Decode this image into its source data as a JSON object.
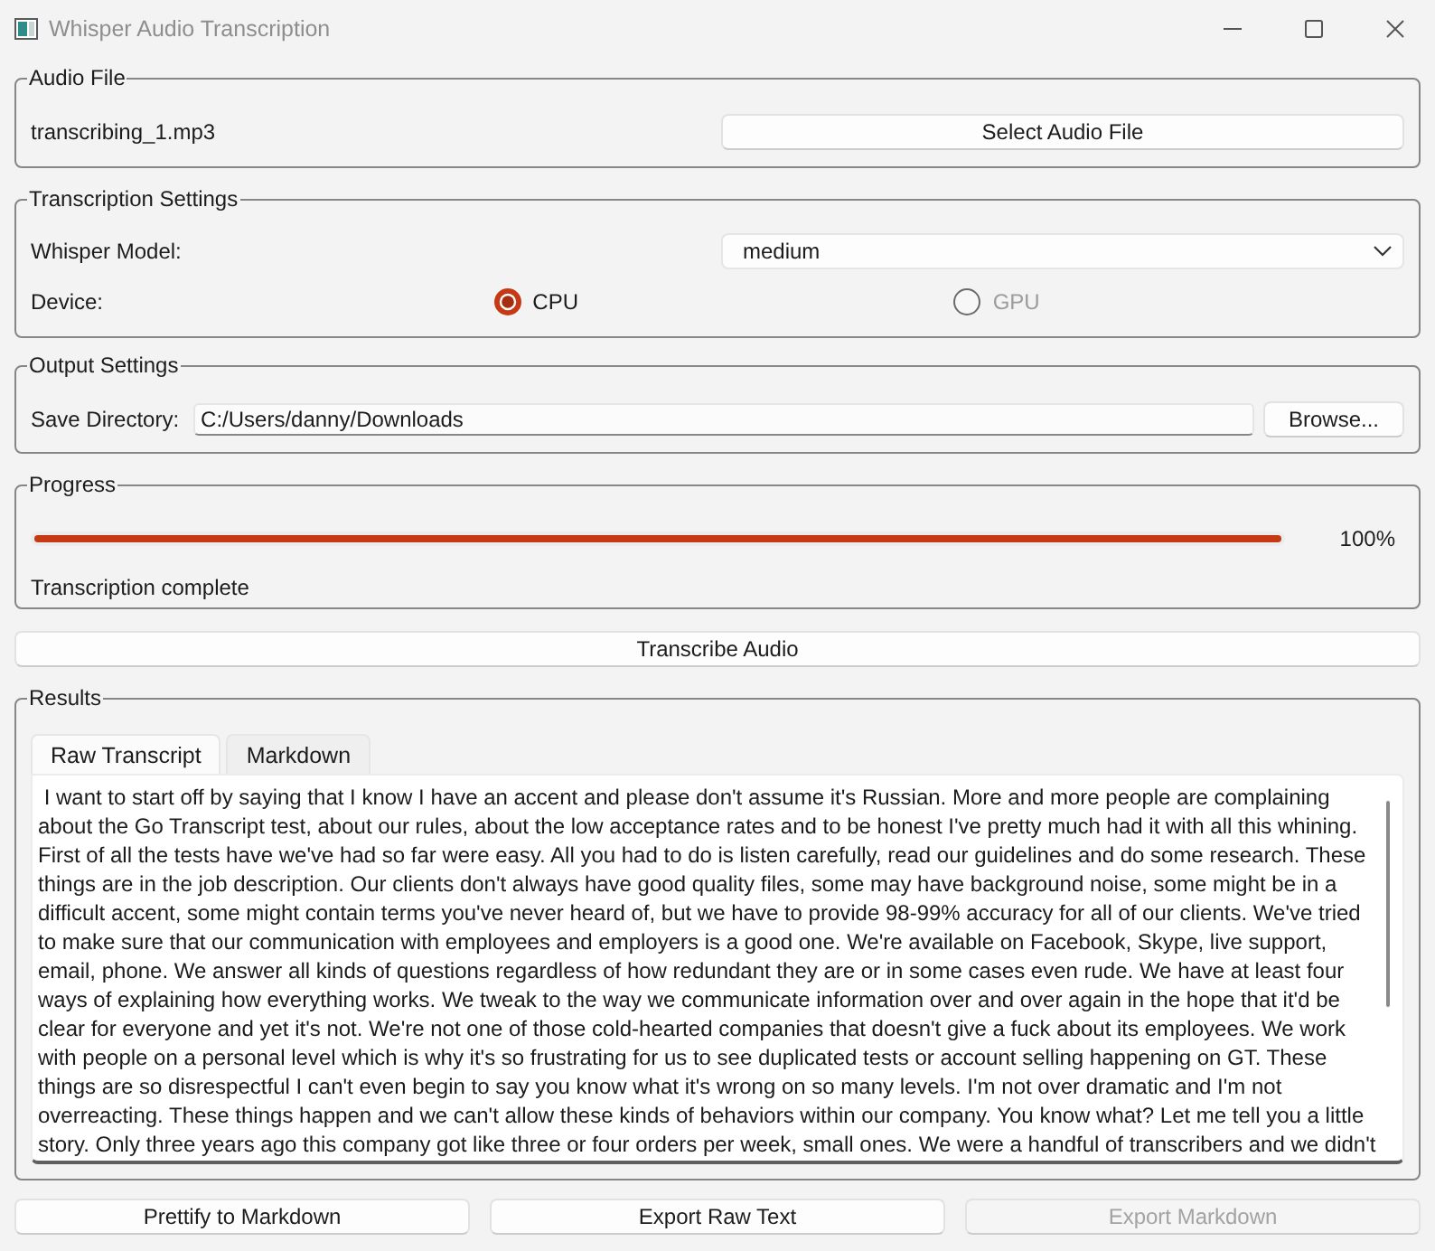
{
  "window": {
    "title": "Whisper Audio Transcription"
  },
  "audio_file": {
    "title": "Audio File",
    "file_name": "transcribing_1.mp3",
    "button": "Select Audio File"
  },
  "transcription_settings": {
    "title": "Transcription Settings",
    "model_label": "Whisper Model:",
    "model_value": "medium",
    "device_label": "Device:",
    "devices": [
      {
        "label": "CPU",
        "selected": true,
        "disabled": false
      },
      {
        "label": "GPU",
        "selected": false,
        "disabled": true
      }
    ]
  },
  "output_settings": {
    "title": "Output Settings",
    "directory_label": "Save Directory:",
    "directory_value": "C:/Users/danny/Downloads",
    "button": "Browse..."
  },
  "progress": {
    "title": "Progress",
    "level": 1,
    "reading": "100%",
    "status": "Transcription complete"
  },
  "transcribe_button": "Transcribe Audio",
  "results": {
    "title": "Results",
    "tabs": [
      {
        "label": "Raw Transcript",
        "selected": true
      },
      {
        "label": "Markdown",
        "selected": false
      }
    ],
    "transcript_lines": [
      " I want to start off by saying that I know I have an accent and please don't assume it's Russian. More and more people are complaining",
      "about the Go Transcript test, about our rules, about the low acceptance rates and to be honest I've pretty much had it with all this whining.",
      "First of all the tests have we've had so far were easy. All you had to do is listen carefully, read our guidelines and do some research. These",
      "things are in the job description. Our clients don't always have good quality files, some may have background noise, some might be in a",
      "difficult accent, some might contain terms you've never heard of, but we have to provide 98-99% accuracy for all of our clients. We've tried",
      "to make sure that our communication with employees and employers is a good one. We're available on Facebook, Skype, live support,",
      "email, phone. We answer all kinds of questions regardless of how redundant they are or in some cases even rude. We have at least four",
      "ways of explaining how everything works. We tweak to the way we communicate information over and over again in the hope that it'd be",
      "clear for everyone and yet it's not. We're not one of those cold-hearted companies that doesn't give a fuck about its employees. We work",
      "with people on a personal level which is why it's so frustrating for us to see duplicated tests or account selling happening on GT. These",
      "things are so disrespectful I can't even begin to say you know what it's wrong on so many levels. I'm not over dramatic and I'm not",
      "overreacting. These things happen and we can't allow these kinds of behaviors within our company. You know what? Let me tell you a little",
      "story. Only three years ago this company got like three or four orders per week, small ones. We were a handful of transcribers and we didn't"
    ]
  },
  "actions": [
    {
      "label": "Prettify to Markdown",
      "disabled": false
    },
    {
      "label": "Export Raw Text",
      "disabled": false
    },
    {
      "label": "Export Markdown",
      "disabled": true
    }
  ]
}
